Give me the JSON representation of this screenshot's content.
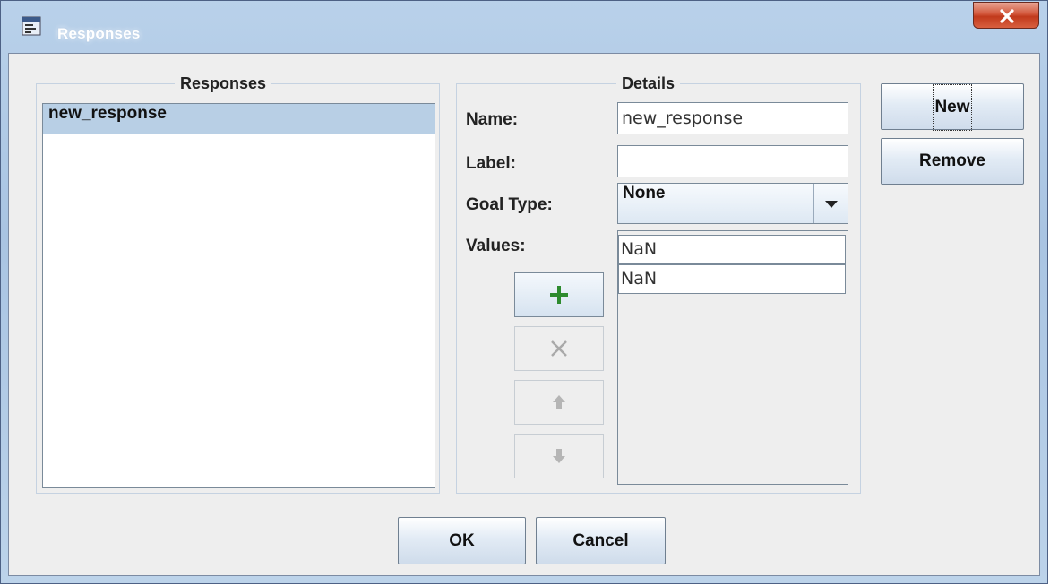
{
  "window": {
    "title": "Responses"
  },
  "responses_panel": {
    "title": "Responses",
    "items": [
      {
        "label": "new_response",
        "selected": true
      }
    ]
  },
  "details_panel": {
    "title": "Details",
    "name_label": "Name:",
    "name_value": "new_response",
    "label_label": "Label:",
    "label_value": "",
    "goal_type_label": "Goal Type:",
    "goal_type_value": "None",
    "values_label": "Values:",
    "values": [
      "NaN",
      "NaN"
    ]
  },
  "value_buttons": {
    "add_icon": "plus-icon",
    "remove_icon": "x-icon",
    "up_icon": "arrow-up-icon",
    "down_icon": "arrow-down-icon"
  },
  "side_buttons": {
    "new_label": "New",
    "remove_label": "Remove"
  },
  "footer": {
    "ok_label": "OK",
    "cancel_label": "Cancel"
  },
  "colors": {
    "selection": "#b8cfe5",
    "add_icon": "#2e8b2e",
    "close_button": "#c9442a"
  }
}
